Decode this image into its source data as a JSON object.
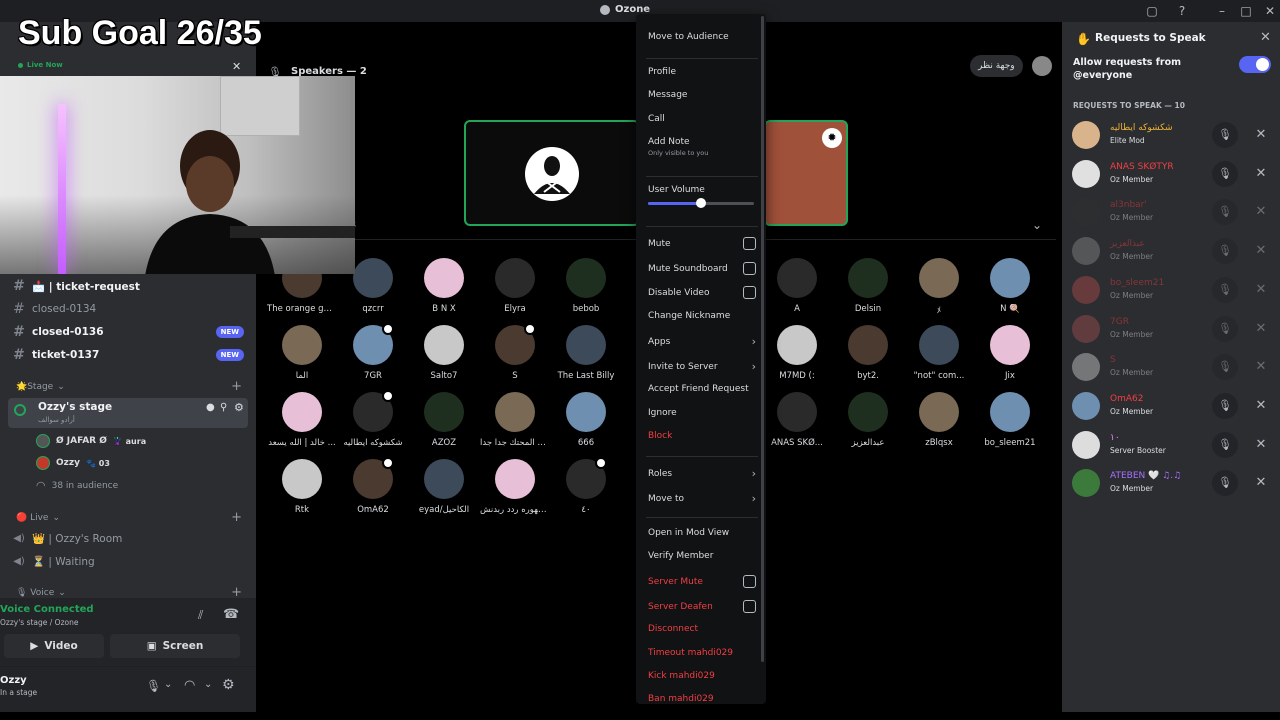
{
  "window": {
    "title": "Ozone"
  },
  "overlay": {
    "sub_goal": "Sub Goal 26/35",
    "live_now": "Live Now"
  },
  "sidebar": {
    "channels": [
      {
        "label": "📩 | ticket-request",
        "bright": true
      },
      {
        "label": "closed-0134",
        "bright": false
      },
      {
        "label": "closed-0136",
        "bright": true,
        "badge": "NEW"
      },
      {
        "label": "ticket-0137",
        "bright": true,
        "badge": "NEW"
      }
    ],
    "stage_category": "🌟Stage",
    "stage_channel": {
      "name": "Ozzy's stage",
      "subtitle": "أرادو سوالف"
    },
    "stage_members": [
      {
        "name": "Ø JAFAR Ø",
        "extra": "🦹 aura"
      },
      {
        "name": "Ozzy",
        "extra": "🐾 03"
      }
    ],
    "audience_count": "38 in audience",
    "live_category": "🔴 Live",
    "live_channels": [
      "👑 | Ozzy's Room",
      "⏳ | Waiting"
    ],
    "voice_category": "🎙 Voice"
  },
  "voice": {
    "status": "Voice Connected",
    "location": "Ozzy's stage / Ozone",
    "video_label": "Video",
    "screen_label": "Screen"
  },
  "user": {
    "name": "Ozzy",
    "status": "In a stage"
  },
  "stage": {
    "speakers_header": "Speakers — 2",
    "audience_header_suffix": "38",
    "speaker_name_tag": "وجهة نظر",
    "audience_rows": [
      [
        "The orange gu...",
        "qzcrr",
        "B N X",
        "Elyra",
        "bebob"
      ],
      [
        "الما",
        "7GR",
        "Salto7",
        "S",
        "The Last Billy"
      ],
      [
        "خالد | الله يسعد ...",
        "شكشوكه ايطاليه",
        "AZOZ",
        "ون المحتك جدا جدا...",
        "666"
      ],
      [
        "Rtk",
        "OmA62",
        "eyad/الكاحيل",
        "شهوره ردد ربدنش...",
        "٤٠"
      ]
    ],
    "audience_right_rows": [
      [
        "A",
        "Delsin",
        "ﾒ",
        "N 🍭"
      ],
      [
        "M7MD (:",
        "byt2.",
        "\"not\" com...",
        "Jix"
      ],
      [
        "ANAS SKØ...",
        "عبدالعزيز",
        "zBlqsx",
        "bo_sleem21"
      ]
    ]
  },
  "context_menu": {
    "items": [
      {
        "label": "Move to Audience",
        "type": "text"
      },
      {
        "label": "Profile",
        "type": "text"
      },
      {
        "label": "Message",
        "type": "text"
      },
      {
        "label": "Call",
        "type": "text"
      },
      {
        "label": "Add Note",
        "type": "text",
        "sub": "Only visible to you"
      },
      {
        "label": "User Volume",
        "type": "slider",
        "value": 0.5
      },
      {
        "label": "Mute",
        "type": "check"
      },
      {
        "label": "Mute Soundboard",
        "type": "check"
      },
      {
        "label": "Disable Video",
        "type": "check"
      },
      {
        "label": "Change Nickname",
        "type": "text"
      },
      {
        "label": "Apps",
        "type": "sub"
      },
      {
        "label": "Invite to Server",
        "type": "sub"
      },
      {
        "label": "Accept Friend Request",
        "type": "text"
      },
      {
        "label": "Ignore",
        "type": "text"
      },
      {
        "label": "Block",
        "type": "danger"
      },
      {
        "label": "Roles",
        "type": "sub"
      },
      {
        "label": "Move to",
        "type": "sub"
      },
      {
        "label": "Open in Mod View",
        "type": "text"
      },
      {
        "label": "Verify Member",
        "type": "text"
      },
      {
        "label": "Server Mute",
        "type": "danger-check"
      },
      {
        "label": "Server Deafen",
        "type": "danger-check"
      },
      {
        "label": "Disconnect",
        "type": "danger"
      },
      {
        "label": "Timeout mahdi029",
        "type": "danger"
      },
      {
        "label": "Kick mahdi029",
        "type": "danger"
      },
      {
        "label": "Ban mahdi029",
        "type": "danger"
      }
    ]
  },
  "requests_panel": {
    "title": "Requests to Speak",
    "allow_label": "Allow requests from @everyone",
    "allow_on": true,
    "section_header": "REQUESTS TO SPEAK — 10",
    "requests": [
      {
        "name": "شكشوكه ايطاليه",
        "role": "Elite Mod",
        "color": "#f0b232"
      },
      {
        "name": "ANAS SKØTYR",
        "role": "Oz Member",
        "color": "#f23f43"
      },
      {
        "name": "al3nbar'",
        "role": "Oz Member",
        "color": "#f23f43"
      },
      {
        "name": "عبدالعزيز",
        "role": "Oz Member",
        "color": "#f23f43"
      },
      {
        "name": "bo_sleem21",
        "role": "Oz Member",
        "color": "#f23f43"
      },
      {
        "name": "7GR",
        "role": "Oz Member",
        "color": "#f23f43"
      },
      {
        "name": "S",
        "role": "Oz Member",
        "color": "#f23f43"
      },
      {
        "name": "OmA62",
        "role": "Oz Member",
        "color": "#f23f43"
      },
      {
        "name": "١٠",
        "role": "Server Booster",
        "color": "#f47fff"
      },
      {
        "name": "ATEBEN 🤍 ♫.♫",
        "role": "Oz Member",
        "color": "#a970ff"
      }
    ]
  },
  "colors": {
    "accent": "#5865f2",
    "green": "#23a559",
    "danger": "#f23f43"
  }
}
